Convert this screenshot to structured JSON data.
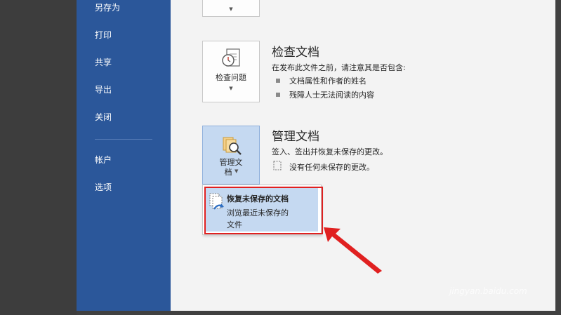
{
  "sidebar": {
    "items": [
      {
        "label": "另存为"
      },
      {
        "label": "打印"
      },
      {
        "label": "共享"
      },
      {
        "label": "导出"
      },
      {
        "label": "关闭"
      },
      {
        "label": "帐户"
      },
      {
        "label": "选项"
      }
    ]
  },
  "inspect": {
    "button_label": "检查问题",
    "title": "检查文档",
    "description": "在发布此文件之前，请注意其是否包含:",
    "bullets": [
      "文档属性和作者的姓名",
      "残障人士无法阅读的内容"
    ]
  },
  "manage": {
    "button_line1": "管理文",
    "button_line2": "档",
    "title": "管理文档",
    "description": "签入、签出并恢复未保存的更改。",
    "status": "没有任何未保存的更改。"
  },
  "dropdown": {
    "title": "恢复未保存的文档",
    "desc_line1": "浏览最近未保存的",
    "desc_line2": "文件"
  },
  "watermark": "jingyan.baidu.com",
  "colors": {
    "sidebar": "#2b579a",
    "highlight": "#e02020",
    "arrow": "#e02020",
    "selected": "#c5d9f1"
  }
}
